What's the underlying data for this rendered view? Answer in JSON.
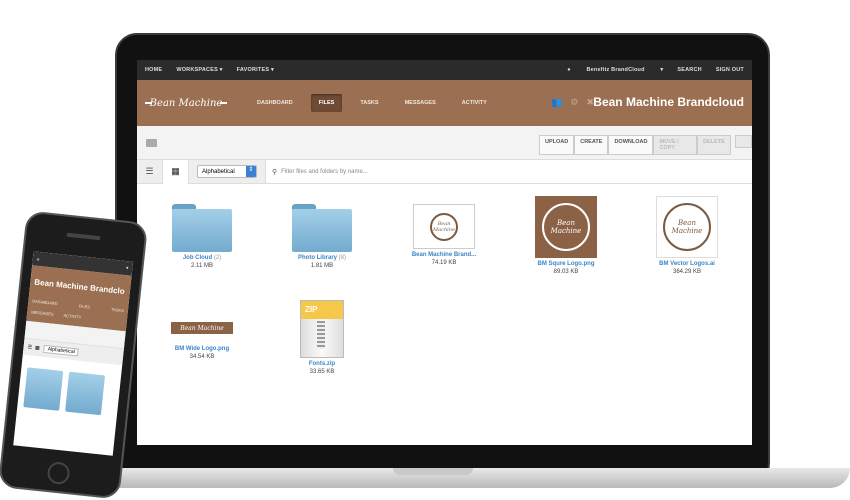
{
  "topnav": {
    "home": "HOME",
    "workspaces": "WORKSPACES",
    "favorites": "FAVORITES",
    "account": "Benefitz BrandCloud",
    "search": "SEARCH",
    "signout": "SIGN OUT"
  },
  "brand": {
    "logo": "Bean Machine",
    "title": "Bean Machine Brandcloud",
    "tabs": [
      "DASHBOARD",
      "FILES",
      "TASKS",
      "MESSAGES",
      "ACTIVITY"
    ],
    "accent": "#9b7052"
  },
  "toolbar": {
    "actions": [
      "UPLOAD",
      "CREATE",
      "DOWNLOAD",
      "MOVE / COPY",
      "DELETE"
    ]
  },
  "filterbar": {
    "sort": "Alphabetical",
    "placeholder": "Filter files and folders by name..."
  },
  "files": [
    {
      "name": "Job Cloud",
      "count": "(2)",
      "size": "2.11 MB",
      "type": "folder"
    },
    {
      "name": "Photo Library",
      "count": "(8)",
      "size": "1.81 MB",
      "type": "folder"
    },
    {
      "name": "Bean Machine Brand...",
      "size": "74.19 KB",
      "type": "image"
    },
    {
      "name": "BM Squre Logo.png",
      "size": "89.03 KB",
      "type": "image"
    },
    {
      "name": "BM Vector Logos.ai",
      "size": "364.29 KB",
      "type": "image"
    },
    {
      "name": "BM Wide Logo.png",
      "size": "34.54 KB",
      "type": "image"
    },
    {
      "name": "Fonts.zip",
      "size": "33.65 KB",
      "type": "zip"
    }
  ],
  "thumbs": {
    "seal_text": "Bean Machine",
    "zip_label": "ZIP"
  },
  "phone": {
    "title": "Bean Machine Brandclo",
    "sort": "Alphabetical"
  }
}
